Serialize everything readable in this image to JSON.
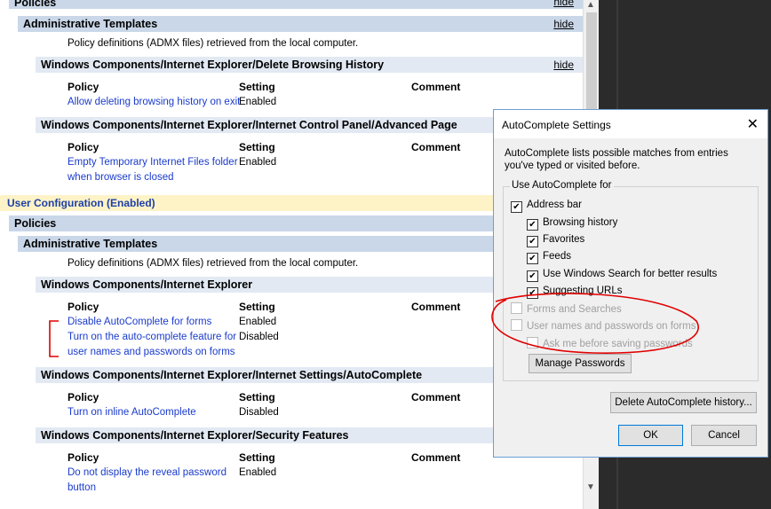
{
  "report": {
    "policies_top_label": "Policies",
    "hide_link": "hide",
    "admin_templates_1": "Administrative Templates",
    "admx_desc_1": "Policy definitions (ADMX files) retrieved from the local computer.",
    "sections_computer": [
      {
        "title": "Windows Components/Internet Explorer/Delete Browsing History",
        "hide": "hide",
        "rows": [
          {
            "policy": "Allow deleting browsing history on exit",
            "setting": "Enabled",
            "comment": ""
          }
        ]
      },
      {
        "title": "Windows Components/Internet Explorer/Internet Control Panel/Advanced Page",
        "rows": [
          {
            "policy_line1": "Empty Temporary Internet Files folder",
            "policy_line2": "when browser is closed",
            "setting": "Enabled",
            "comment": ""
          }
        ]
      }
    ],
    "columns": {
      "policy": "Policy",
      "setting": "Setting",
      "comment": "Comment"
    },
    "user_config": "User Configuration (Enabled)",
    "policies_label": "Policies",
    "admin_templates_2": "Administrative Templates",
    "admx_desc_2": "Policy definitions (ADMX files) retrieved from the local computer.",
    "sections_user": [
      {
        "title": "Windows Components/Internet Explorer",
        "rows": [
          {
            "policy": "Disable AutoComplete for forms",
            "setting": "Enabled"
          },
          {
            "policy_line1": "Turn on the auto-complete feature for",
            "policy_line2": "user names and passwords on forms",
            "setting": "Disabled"
          }
        ]
      },
      {
        "title": "Windows Components/Internet Explorer/Internet Settings/AutoComplete",
        "rows": [
          {
            "policy": "Turn on inline AutoComplete",
            "setting": "Disabled"
          }
        ]
      },
      {
        "title": "Windows Components/Internet Explorer/Security Features",
        "rows": [
          {
            "policy_line1": "Do not display the reveal password",
            "policy_line2": "button",
            "setting": "Enabled"
          }
        ]
      }
    ]
  },
  "dialog": {
    "title": "AutoComplete Settings",
    "close_icon": "close-icon",
    "description": "AutoComplete lists possible matches from entries you've typed or visited before.",
    "group_label": "Use AutoComplete for",
    "options": [
      {
        "label": "Address bar",
        "checked": true,
        "enabled": true
      },
      {
        "label": "Browsing history",
        "checked": true,
        "enabled": true
      },
      {
        "label": "Favorites",
        "checked": true,
        "enabled": true
      },
      {
        "label": "Feeds",
        "checked": true,
        "enabled": true
      },
      {
        "label": "Use Windows Search for better results",
        "checked": true,
        "enabled": true
      },
      {
        "label": "Suggesting URLs",
        "checked": true,
        "enabled": true
      },
      {
        "label": "Forms and Searches",
        "checked": false,
        "enabled": false
      },
      {
        "label": "User names and passwords on forms",
        "checked": false,
        "enabled": false
      },
      {
        "label": "Ask me before saving passwords",
        "checked": false,
        "enabled": false
      }
    ],
    "manage_passwords": "Manage Passwords",
    "delete_history": "Delete AutoComplete history...",
    "ok": "OK",
    "cancel": "Cancel"
  },
  "colors": {
    "accent": "#0078d7",
    "link": "#1a3bcc",
    "annotation": "#e00000",
    "header_bg": "#c9d7e8"
  }
}
